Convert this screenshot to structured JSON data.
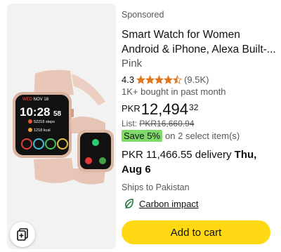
{
  "listing": {
    "sponsored_label": "Sponsored",
    "title_line1": "Smart Watch for Women",
    "title_line2": "Android & iPhone, Alexa Built-...",
    "variant": "Pink",
    "rating": "4.3",
    "stars_filled": 4.3,
    "stars_total": 5,
    "review_count": "(9.5K)",
    "bought_text": "1K+ bought in past month",
    "price": {
      "currency": "PKR",
      "whole": "12,494",
      "fraction": "32"
    },
    "list_price_label": "List:",
    "list_price": "PKR16,660.94",
    "save_badge": "Save 5%",
    "save_text": "on 2 select item(s)",
    "delivery_prefix": "PKR 11,466.55 delivery",
    "delivery_date_part1": "Thu,",
    "delivery_date_part2": "Aug 6",
    "ships_to": "Ships to Pakistan",
    "carbon_label": "Carbon impact",
    "add_to_cart": "Add to cart"
  },
  "watch_screen": {
    "date": "WED NOV 18",
    "time_hm": "10:28",
    "time_s": "58",
    "steps": "52218 steps",
    "kcal": "1218 kcal"
  },
  "icons": {
    "compare": "compare-icon",
    "star": "star-icon",
    "leaf": "leaf-icon"
  },
  "colors": {
    "cart_button": "#ffd814",
    "save_badge": "#7fda69",
    "star": "#de7921"
  }
}
